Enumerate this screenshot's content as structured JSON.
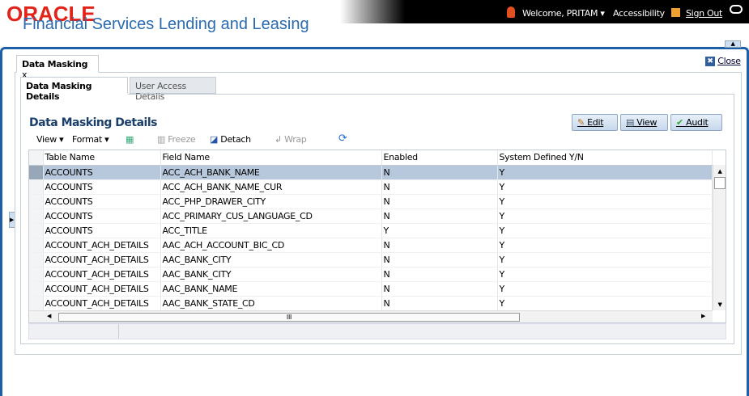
{
  "header": {
    "logo": "ORACLE",
    "product": "Financial Services Lending and Leasing",
    "welcome": "Welcome, PRITAM",
    "accessibility": "Accessibility",
    "sign_out": "Sign Out"
  },
  "main_tab": {
    "label": "Data Masking",
    "close_x": "x"
  },
  "close_label": "Close",
  "subtabs": [
    {
      "label": "Data Masking Details",
      "active": true
    },
    {
      "label": "User Access Details",
      "active": false
    }
  ],
  "section_title": "Data Masking Details",
  "buttons": {
    "edit": "Edit",
    "view": "View",
    "audit": "Audit"
  },
  "toolbar": {
    "view": "View",
    "format": "Format",
    "freeze": "Freeze",
    "detach": "Detach",
    "wrap": "Wrap"
  },
  "table": {
    "columns": [
      "Table Name",
      "Field Name",
      "Enabled",
      "System Defined Y/N"
    ],
    "rows": [
      [
        "ACCOUNTS",
        "ACC_ACH_BANK_NAME",
        "N",
        "Y"
      ],
      [
        "ACCOUNTS",
        "ACC_ACH_BANK_NAME_CUR",
        "N",
        "Y"
      ],
      [
        "ACCOUNTS",
        "ACC_PHP_DRAWER_CITY",
        "N",
        "Y"
      ],
      [
        "ACCOUNTS",
        "ACC_PRIMARY_CUS_LANGUAGE_CD",
        "N",
        "Y"
      ],
      [
        "ACCOUNTS",
        "ACC_TITLE",
        "Y",
        "Y"
      ],
      [
        "ACCOUNT_ACH_DETAILS",
        "AAC_ACH_ACCOUNT_BIC_CD",
        "N",
        "Y"
      ],
      [
        "ACCOUNT_ACH_DETAILS",
        "AAC_BANK_CITY",
        "N",
        "Y"
      ],
      [
        "ACCOUNT_ACH_DETAILS",
        "AAC_BANK_CITY",
        "N",
        "Y"
      ],
      [
        "ACCOUNT_ACH_DETAILS",
        "AAC_BANK_NAME",
        "N",
        "Y"
      ],
      [
        "ACCOUNT_ACH_DETAILS",
        "AAC_BANK_STATE_CD",
        "N",
        "Y"
      ]
    ],
    "selected_row": 0
  },
  "hscroll_label": "III"
}
